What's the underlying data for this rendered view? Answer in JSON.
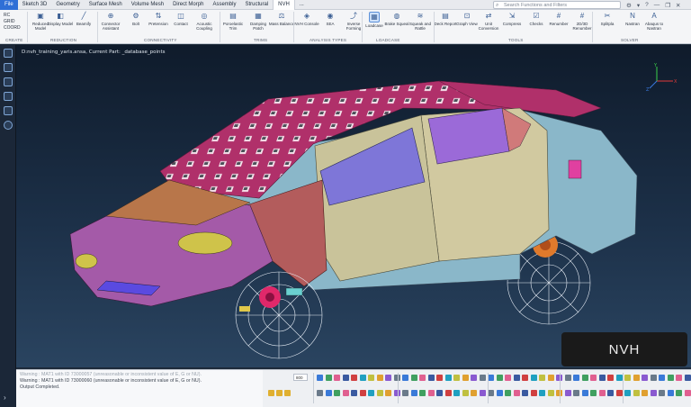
{
  "menu": {
    "items": [
      "File",
      "Sketch 3D",
      "Geometry",
      "Surface Mesh",
      "Volume Mesh",
      "Direct Morph",
      "Assembly",
      "Structural",
      "NVH",
      "..."
    ],
    "active_index": 8
  },
  "search": {
    "placeholder": "Search Functions and Filters"
  },
  "ribbon": {
    "create_list": [
      "RC",
      "GRID",
      "COORD"
    ],
    "buttons": [
      {
        "label": "Reduced Model",
        "icon": "reduced-model-icon"
      },
      {
        "label": "Display Model",
        "icon": "display-model-icon"
      },
      {
        "label": "Beamify",
        "icon": "beamify-icon"
      },
      {
        "label": "Connector Assistant",
        "icon": "connector-assistant-icon"
      },
      {
        "label": "Bolt",
        "icon": "bolt-icon"
      },
      {
        "label": "Pretension",
        "icon": "pretension-icon"
      },
      {
        "label": "Contact",
        "icon": "contact-icon"
      },
      {
        "label": "Acoustic Coupling",
        "icon": "acoustic-coupling-icon"
      },
      {
        "label": "Poroelastic Trim",
        "icon": "poroelastic-trim-icon"
      },
      {
        "label": "Damping Patch",
        "icon": "damping-patch-icon"
      },
      {
        "label": "Mass Balance",
        "icon": "mass-balance-icon"
      },
      {
        "label": "NVH Console",
        "icon": "nvh-console-icon"
      },
      {
        "label": "SEA",
        "icon": "sea-icon"
      },
      {
        "label": "Inverse Forming",
        "icon": "inverse-forming-icon"
      },
      {
        "label": "Loadcase",
        "icon": "loadcase-icon"
      },
      {
        "label": "Brake Squeal",
        "icon": "brake-squeal-icon"
      },
      {
        "label": "Squeak and Rattle",
        "icon": "squeak-rattle-icon"
      },
      {
        "label": "Deck Report",
        "icon": "deck-report-icon"
      },
      {
        "label": "Graph View",
        "icon": "graph-view-icon"
      },
      {
        "label": "Unit Conversion",
        "icon": "unit-conversion-icon"
      },
      {
        "label": "Compress",
        "icon": "compress-icon"
      },
      {
        "label": "Checks",
        "icon": "checks-icon"
      },
      {
        "label": "Renumber",
        "icon": "renumber-icon"
      },
      {
        "label": "2D/3D Renumber",
        "icon": "renumber-2d3d-icon"
      },
      {
        "label": "Splitpla",
        "icon": "splitpla-icon"
      },
      {
        "label": "Nastran",
        "icon": "nastran-icon"
      },
      {
        "label": "Abaqus to Nastran",
        "icon": "abaqus-to-nastran-icon"
      }
    ],
    "groups": [
      "CREATE",
      "REDUCTION",
      "CONNECTIVITY",
      "TRIMS",
      "ANALYSIS TYPES",
      "LOADCASE",
      "TOOLS",
      "SOLVER"
    ]
  },
  "viewport": {
    "title": "D:nvh_training_yaris.ansa, Current Part: _database_points",
    "axes": {
      "x": "X",
      "y": "Y",
      "z": "Z"
    }
  },
  "overlay_label": "NVH",
  "console": {
    "lines": [
      "Warning : MAT1 with ID 73000057 (unreasonable or inconsistent value of E, G or NU).",
      "Warning : MAT1 with ID 73000060 (unreasonable or inconsistent value of E, G or NU).",
      "Output Completed."
    ]
  },
  "bottombar": {
    "field_value": "800"
  },
  "colors": {
    "accent": "#2f6fd6",
    "body_blue": "#8ab7c9",
    "hood_purple": "#a15aa8",
    "roof_magenta": "#b0306a",
    "door_tan": "#c9c39a",
    "fender_red": "#b05a5a"
  }
}
